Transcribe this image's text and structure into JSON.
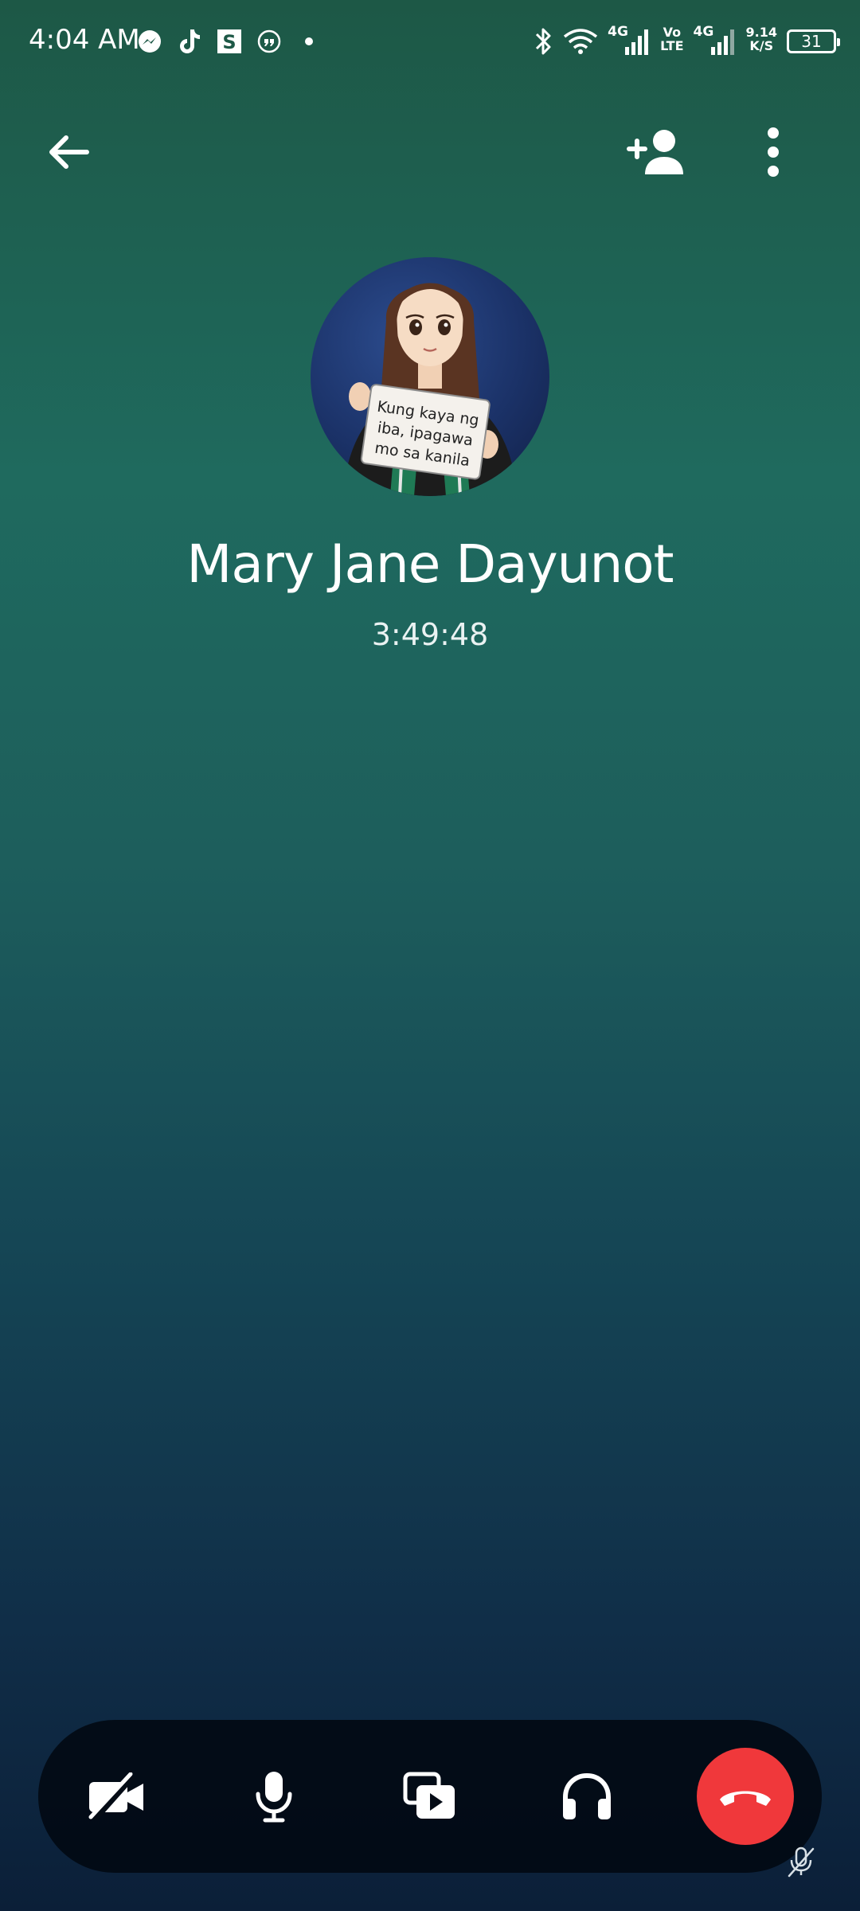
{
  "status_bar": {
    "time": "4:04 AM",
    "notification_icons": [
      "messenger-icon",
      "tiktok-icon",
      "s-app-icon",
      "quote-app-icon",
      "dot-icon"
    ],
    "s_app_letter": "S",
    "network_1": "4G",
    "volte_top": "Vo",
    "volte_bottom": "LTE",
    "network_2": "4G",
    "speed_value": "9.14",
    "speed_unit": "K/S",
    "battery": "31"
  },
  "top_bar": {
    "back": "back-arrow-icon",
    "add_person": "add-person-icon",
    "more": "more-vert-icon"
  },
  "call": {
    "caller_name": "Mary Jane Dayunot",
    "duration": "3:49:48",
    "avatar_sign_line1": "Kung kaya ng",
    "avatar_sign_line2": "iba, ipagawa",
    "avatar_sign_line3": "mo sa kanila"
  },
  "controls": [
    {
      "name": "video-off",
      "icon": "video-off-icon"
    },
    {
      "name": "microphone",
      "icon": "microphone-icon"
    },
    {
      "name": "share-media",
      "icon": "share-media-icon"
    },
    {
      "name": "audio-output",
      "icon": "headphones-icon"
    },
    {
      "name": "end-call",
      "icon": "end-call-icon",
      "color": "#f0383b"
    }
  ],
  "colors": {
    "gradient_top": "#1d5846",
    "gradient_bottom": "#0b1f38",
    "end_call": "#f0383b"
  }
}
